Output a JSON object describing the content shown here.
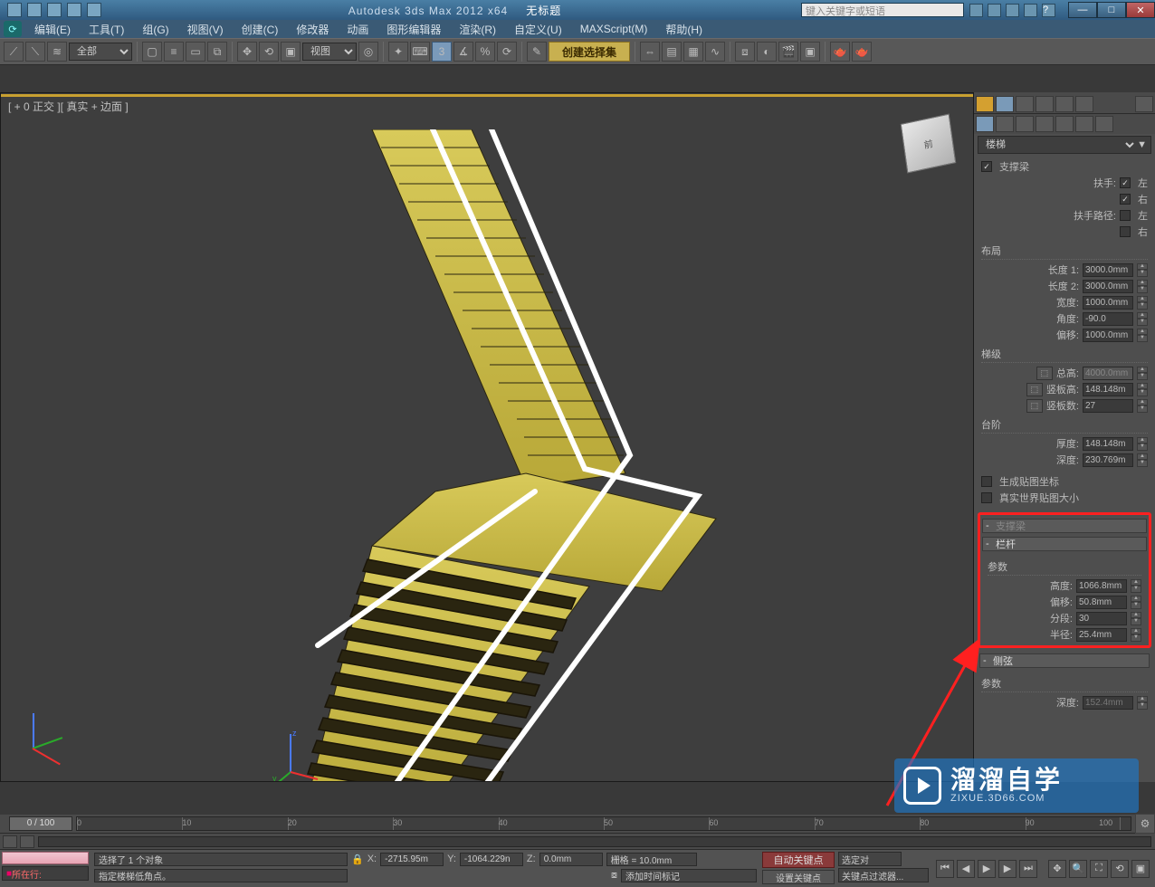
{
  "title": {
    "app": "Autodesk 3ds Max 2012 x64",
    "doc": "无标题",
    "search_placeholder": "键入关键字或短语"
  },
  "winbtns": {
    "min": "—",
    "max": "□",
    "close": "✕"
  },
  "menus": [
    "编辑(E)",
    "工具(T)",
    "组(G)",
    "视图(V)",
    "创建(C)",
    "修改器",
    "动画",
    "图形编辑器",
    "渲染(R)",
    "自定义(U)",
    "MAXScript(M)",
    "帮助(H)"
  ],
  "toolbar1": {
    "sel_all": "全部",
    "view_dd": "视图",
    "create_set": "创建选择集"
  },
  "viewport": {
    "label": "[ + 0 正交 ][ 真实 + 边面 ]",
    "cube": "前"
  },
  "cmd": {
    "obj_type": "楼梯",
    "gen": {
      "stringer_chk": true,
      "stringer": "支撑梁",
      "handrail": "扶手:",
      "hr_left_chk": true,
      "hr_left": "左",
      "hr_right_chk": true,
      "hr_right": "右",
      "railpath": "扶手路径:",
      "rp_left_chk": false,
      "rp_left": "左",
      "rp_right_chk": false,
      "rp_right": "右"
    },
    "layout": {
      "head": "布局",
      "len1_l": "长度 1:",
      "len1": "3000.0mm",
      "len2_l": "长度 2:",
      "len2": "3000.0mm",
      "width_l": "宽度:",
      "width": "1000.0mm",
      "angle_l": "角度:",
      "angle": "-90.0",
      "offset_l": "偏移:",
      "offset": "1000.0mm"
    },
    "rise": {
      "head": "梯级",
      "total_l": "总高:",
      "total": "4000.0mm",
      "riser_l": "竖板高:",
      "riser": "148.148m",
      "count_l": "竖板数:",
      "count": "27"
    },
    "step": {
      "head": "台阶",
      "thick_l": "厚度:",
      "thick": "148.148m",
      "depth_l": "深度:",
      "depth": "230.769m"
    },
    "mapcoords_chk": false,
    "mapcoords": "生成贴图坐标",
    "realworld_chk": false,
    "realworld": "真实世界贴图大小",
    "stringer_roll": "支撑梁",
    "rail": {
      "head": "栏杆",
      "param": "参数",
      "height_l": "高度:",
      "height": "1066.8mm",
      "offset_l": "偏移:",
      "offset": "50.8mm",
      "segs_l": "分段:",
      "segs": "30",
      "radius_l": "半径:",
      "radius": "25.4mm"
    },
    "side": {
      "head": "侧弦",
      "param": "参数",
      "depth_l": "深度:",
      "depth": "152.4mm"
    }
  },
  "timeline": {
    "pos": "0 / 100"
  },
  "status": {
    "now_at": "所在行:",
    "sel": "选择了 1 个对象",
    "hint": "指定楼梯低角点。",
    "lock": "🔒",
    "x_l": "X:",
    "x": "-2715.95m",
    "y_l": "Y:",
    "y": "-1064.229n",
    "z_l": "Z:",
    "z": "0.0mm",
    "grid": "栅格 = 10.0mm",
    "addtime": "添加时间标记",
    "autokey": "自动关键点",
    "setkey": "设置关键点",
    "selmode": "选定对",
    "keyfilter": "关键点过滤器..."
  },
  "watermark": {
    "main": "溜溜自学",
    "sub": "ZIXUE.3D66.COM"
  }
}
